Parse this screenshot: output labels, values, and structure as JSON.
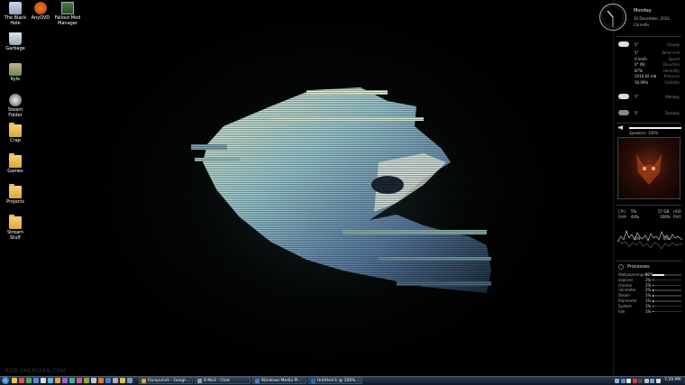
{
  "desktop_icons": [
    {
      "label1": "The Black",
      "label2": "Hole",
      "kind": "recycle"
    },
    {
      "label1": "AnyDVD",
      "label2": "",
      "kind": "fox"
    },
    {
      "label1": "Fallout Mod",
      "label2": "Manager",
      "kind": "app"
    },
    {
      "label1": "Garbage",
      "label2": "",
      "kind": "bin"
    },
    {
      "label1": "Kyle",
      "label2": "",
      "kind": "user"
    },
    {
      "label1": "Steam Folder",
      "label2": "",
      "kind": "steam"
    },
    {
      "label1": "Crap",
      "label2": "",
      "kind": "folder"
    },
    {
      "label1": "Games",
      "label2": "",
      "kind": "folder"
    },
    {
      "label1": "Projects",
      "label2": "",
      "kind": "folder"
    },
    {
      "label1": "Stream Stuff",
      "label2": "",
      "kind": "folder"
    }
  ],
  "watermark": "ROB-SHERIDAN.COM",
  "clock": {
    "day": "Monday",
    "date": "10 December, 2012",
    "location": "Cornellis"
  },
  "weather": {
    "current": {
      "temp": "5°",
      "cond": "Cloudy"
    },
    "details": [
      {
        "v": "5°",
        "k": "Wind chill"
      },
      {
        "v": "0 km/h",
        "k": "Speed"
      },
      {
        "v": "0° (N)",
        "k": "Direction"
      },
      {
        "v": "87%",
        "k": "Humidity"
      },
      {
        "v": "1019.92 mb",
        "k": "Pressure"
      },
      {
        "v": "16.09%",
        "k": "Visibility"
      }
    ],
    "tomorrow": {
      "temp": "7°",
      "label": "Monday"
    },
    "next": {
      "temp": "5°",
      "label": "Tuesday"
    }
  },
  "volume": {
    "label": "Speakers: 100%",
    "level": 1.0
  },
  "system": {
    "cpu_label": "CPU",
    "cpu_val": "5%",
    "ram_label": "RAM",
    "ram_val": "44%",
    "hdd_val": "57 GB",
    "hdd_label": "HDD",
    "pwr_val": "100%",
    "pwr_label": "PWR",
    "net_left": "5%",
    "net_right": "6%"
  },
  "processes": {
    "title": "Processes",
    "items": [
      {
        "name": "Wallpaperengine",
        "val": "42%",
        "frac": 0.42
      },
      {
        "name": "explorer",
        "val": "2%",
        "frac": 0.02
      },
      {
        "name": "chrome",
        "val": "2%",
        "frac": 0.02
      },
      {
        "name": "rainmeter",
        "val": "2%",
        "frac": 0.02
      },
      {
        "name": "Steam",
        "val": "1%",
        "frac": 0.01
      },
      {
        "name": "Rainmeter",
        "val": "1%",
        "frac": 0.01
      },
      {
        "name": "System",
        "val": "1%",
        "frac": 0.01
      },
      {
        "name": "Idle",
        "val": "1%",
        "frac": 0.01
      }
    ]
  },
  "taskbar": {
    "tasks": [
      {
        "label": "Facepunch - Googl...",
        "color": "#d9a23a"
      },
      {
        "label": "8 Mo3 - Chat",
        "color": "#8aa0b5"
      },
      {
        "label": "Windows Media Pl...",
        "color": "#4a7bd1"
      },
      {
        "label": "Untitled-1 @ 100% ...",
        "color": "#2b6bc7"
      }
    ],
    "time": "7:29 PM"
  }
}
